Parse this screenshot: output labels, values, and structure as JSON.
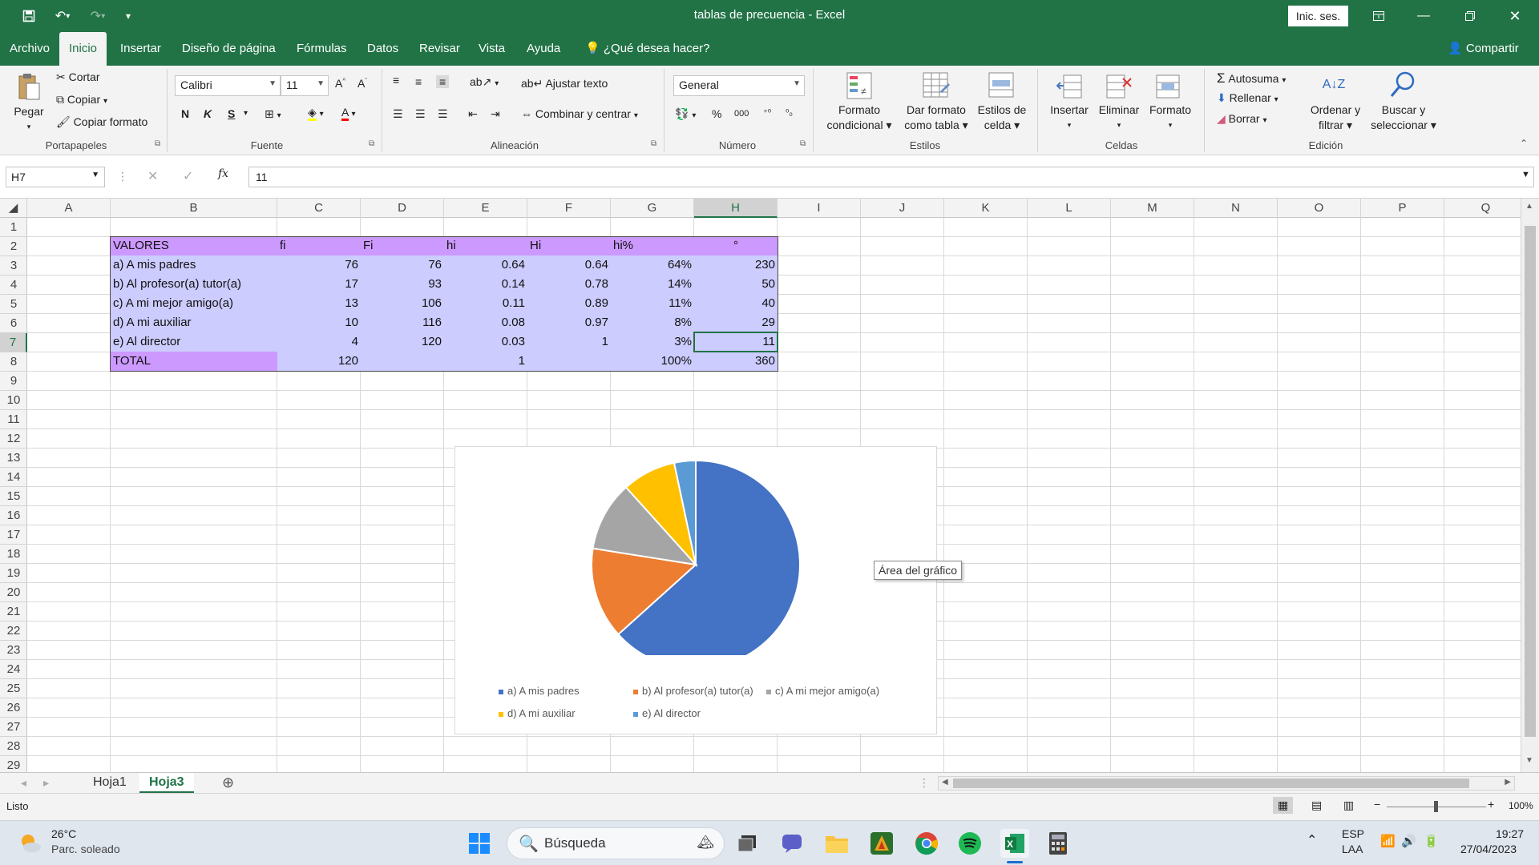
{
  "window": {
    "title": "tablas de precuencia  -  Excel",
    "signin_label": "Inic. ses."
  },
  "menu": {
    "tabs": [
      "Archivo",
      "Inicio",
      "Insertar",
      "Diseño de página",
      "Fórmulas",
      "Datos",
      "Revisar",
      "Vista",
      "Ayuda"
    ],
    "active_tab": "Inicio",
    "tell_me": "¿Qué desea hacer?",
    "share": "Compartir"
  },
  "ribbon": {
    "clipboard": {
      "paste": "Pegar",
      "cut": "Cortar",
      "copy": "Copiar",
      "format_painter": "Copiar formato",
      "label": "Portapapeles"
    },
    "font": {
      "name": "Calibri",
      "size": "11",
      "bold": "N",
      "italic": "K",
      "underline": "S",
      "label": "Fuente"
    },
    "alignment": {
      "wrap": "Ajustar texto",
      "merge": "Combinar y centrar",
      "label": "Alineación"
    },
    "number": {
      "format": "General",
      "percent": "%",
      "thousands": "000",
      "label": "Número"
    },
    "styles": {
      "conditional_1": "Formato",
      "conditional_2": "condicional",
      "table_1": "Dar formato",
      "table_2": "como tabla",
      "cell_1": "Estilos de",
      "cell_2": "celda",
      "label": "Estilos"
    },
    "cells": {
      "insert": "Insertar",
      "delete": "Eliminar",
      "format": "Formato",
      "label": "Celdas"
    },
    "editing": {
      "autosum": "Autosuma",
      "fill": "Rellenar",
      "clear": "Borrar",
      "sort_1": "Ordenar y",
      "sort_2": "filtrar",
      "find_1": "Buscar y",
      "find_2": "seleccionar",
      "label": "Edición"
    }
  },
  "formula_bar": {
    "name_box": "H7",
    "fx": "fx",
    "content": "11"
  },
  "grid": {
    "columns": [
      "A",
      "B",
      "C",
      "D",
      "E",
      "F",
      "G",
      "H",
      "I",
      "J",
      "K",
      "L",
      "M",
      "N",
      "O",
      "P",
      "Q"
    ],
    "rows": [
      "1",
      "2",
      "3",
      "4",
      "5",
      "6",
      "7",
      "8",
      "9",
      "10",
      "11",
      "12",
      "13",
      "14",
      "15",
      "16",
      "17",
      "18",
      "19",
      "20",
      "21",
      "22",
      "23",
      "24",
      "25",
      "26",
      "27",
      "28",
      "29"
    ],
    "selected_col": "H",
    "selected_row": "7"
  },
  "table": {
    "headers": [
      "VALORES",
      "fi",
      "Fi",
      "hi",
      "Hi",
      "hi%",
      "°"
    ],
    "rows": [
      [
        "a) A mis padres",
        "76",
        "76",
        "0.64",
        "0.64",
        "64%",
        "230"
      ],
      [
        "b) Al profesor(a) tutor(a)",
        "17",
        "93",
        "0.14",
        "0.78",
        "14%",
        "50"
      ],
      [
        "c) A mi mejor amigo(a)",
        "13",
        "106",
        "0.11",
        "0.89",
        "11%",
        "40"
      ],
      [
        "d) A mi auxiliar",
        "10",
        "116",
        "0.08",
        "0.97",
        "8%",
        "29"
      ],
      [
        "e) Al director",
        "4",
        "120",
        "0.03",
        "1",
        "3%",
        "11"
      ],
      [
        "TOTAL",
        "120",
        "",
        "1",
        "",
        "100%",
        "360"
      ]
    ]
  },
  "chart_data": {
    "type": "pie",
    "categories": [
      "a) A mis padres",
      "b) Al profesor(a) tutor(a)",
      "c) A mi mejor amigo(a)",
      "d) A mi auxiliar",
      "e) Al director"
    ],
    "values": [
      76,
      17,
      13,
      10,
      4
    ],
    "colors": [
      "#4472c4",
      "#ed7d31",
      "#a5a5a5",
      "#ffc000",
      "#5b9bd5"
    ],
    "title": "",
    "legend_position": "bottom"
  },
  "chart_tooltip": "Área del gráfico",
  "sheets": {
    "tabs": [
      "Hoja1",
      "Hoja3"
    ],
    "active": "Hoja3"
  },
  "status": {
    "ready": "Listo",
    "zoom": "100%"
  },
  "taskbar": {
    "weather_temp": "26°C",
    "weather_desc": "Parc. soleado",
    "search_placeholder": "Búsqueda",
    "lang_1": "ESP",
    "lang_2": "LAA",
    "time": "19:27",
    "date": "27/04/2023"
  }
}
